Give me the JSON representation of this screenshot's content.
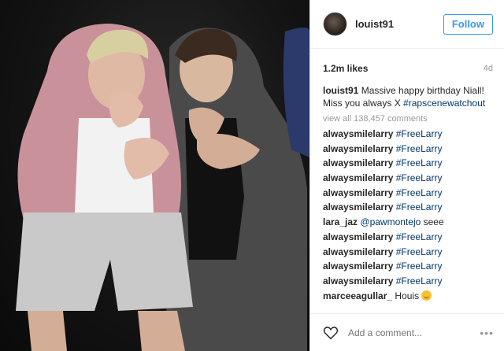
{
  "post": {
    "username": "louist91",
    "follow_label": "Follow",
    "likes": "1.2m likes",
    "age": "4d",
    "caption_user": "louist91",
    "caption_text": "Massive happy birthday Niall! Miss you always X",
    "caption_hashtag": "#rapscenewatchout",
    "view_all": "view all 138,457 comments"
  },
  "comments": [
    {
      "user": "alwaysmilelarry",
      "text": "#FreeLarry"
    },
    {
      "user": "alwaysmilelarry",
      "text": "#FreeLarry"
    },
    {
      "user": "alwaysmilelarry",
      "text": "#FreeLarry"
    },
    {
      "user": "alwaysmilelarry",
      "text": "#FreeLarry"
    },
    {
      "user": "alwaysmilelarry",
      "text": "#FreeLarry"
    },
    {
      "user": "alwaysmilelarry",
      "text": "#FreeLarry"
    },
    {
      "user": "lara_jaz",
      "text": "@pawmontejo",
      "extra": "seee"
    },
    {
      "user": "alwaysmilelarry",
      "text": "#FreeLarry"
    },
    {
      "user": "alwaysmilelarry",
      "text": "#FreeLarry"
    },
    {
      "user": "alwaysmilelarry",
      "text": "#FreeLarry"
    },
    {
      "user": "alwaysmilelarry",
      "text": "#FreeLarry"
    },
    {
      "user": "marceeagullar_",
      "text": "Houis"
    }
  ],
  "footer": {
    "add_comment_placeholder": "Add a comment...",
    "more_icon": "more-options-icon"
  },
  "colors": {
    "link": "#003569",
    "follow": "#3897f0",
    "muted": "#999999"
  }
}
